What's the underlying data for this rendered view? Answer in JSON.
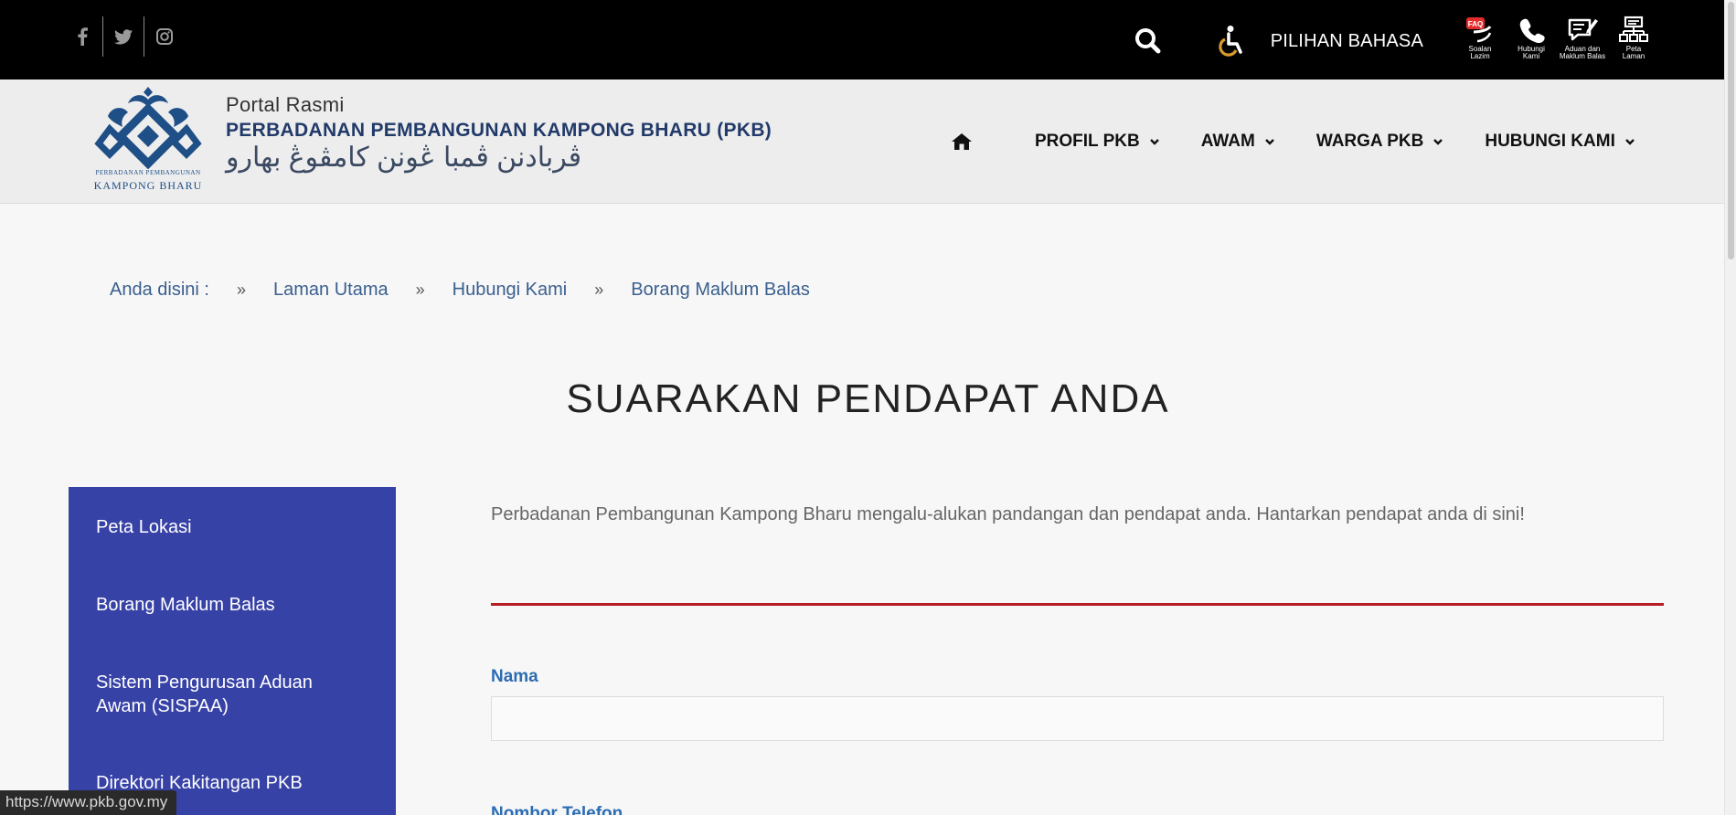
{
  "topbar": {
    "social": [
      {
        "icon": "facebook-icon",
        "glyph": "f"
      },
      {
        "icon": "twitter-icon",
        "glyph": ""
      },
      {
        "icon": "instagram-icon",
        "glyph": ""
      }
    ],
    "language_label": "PILIHAN BAHASA",
    "quick_links": [
      {
        "icon": "faq-icon",
        "badge": "FAQ",
        "label_1": "Soalan",
        "label_2": "Lazim"
      },
      {
        "icon": "phone-icon",
        "label_1": "Hubungi",
        "label_2": "Kami"
      },
      {
        "icon": "feedback-icon",
        "label_1": "Aduan dan",
        "label_2": "Maklum Balas"
      },
      {
        "icon": "sitemap-icon",
        "label_1": "Peta",
        "label_2": "Laman"
      }
    ]
  },
  "header": {
    "logo_text_small": "PERBADANAN PEMBANGUNAN",
    "logo_text_large": "KAMPONG BHARU",
    "portal_label": "Portal Rasmi",
    "org_name": "PERBADANAN PEMBANGUNAN KAMPONG BHARU (PKB)",
    "org_name_jawi": "ڤربادنن ڤمبا ڠونن كامڤوڠ بهارو",
    "nav": [
      {
        "label": "PROFIL PKB"
      },
      {
        "label": "AWAM"
      },
      {
        "label": "WARGA PKB"
      },
      {
        "label": "HUBUNGI KAMI"
      }
    ]
  },
  "breadcrumb": {
    "lead": "Anda disini :",
    "separator": "»",
    "items": [
      "Laman Utama",
      "Hubungi Kami",
      "Borang Maklum Balas"
    ]
  },
  "page_title": "SUARAKAN PENDAPAT ANDA",
  "sidebar": {
    "items": [
      "Peta Lokasi",
      "Borang Maklum Balas",
      "Sistem Pengurusan Aduan Awam (SISPAA)",
      "Direktori Kakitangan PKB"
    ]
  },
  "content": {
    "intro": "Perbadanan Pembangunan Kampong Bharu mengalu-alukan pandangan dan pendapat anda. Hantarkan pendapat anda di sini!",
    "fields": [
      {
        "label": "Nama",
        "value": ""
      },
      {
        "label": "Nombor Telefon"
      }
    ]
  },
  "status_url": "https://www.pkb.gov.my",
  "colors": {
    "topbar": "#000000",
    "sidebar": "#3742a6",
    "divider": "#b51f24",
    "label": "#2b6cb3",
    "link": "#3a5f8f"
  }
}
